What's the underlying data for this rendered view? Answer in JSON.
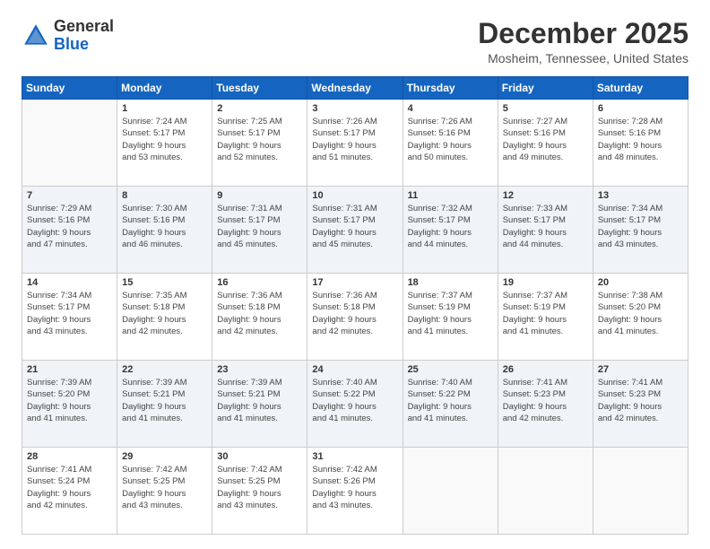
{
  "logo": {
    "general": "General",
    "blue": "Blue"
  },
  "header": {
    "month": "December 2025",
    "location": "Mosheim, Tennessee, United States"
  },
  "days_of_week": [
    "Sunday",
    "Monday",
    "Tuesday",
    "Wednesday",
    "Thursday",
    "Friday",
    "Saturday"
  ],
  "weeks": [
    [
      {
        "day": "",
        "info": ""
      },
      {
        "day": "1",
        "info": "Sunrise: 7:24 AM\nSunset: 5:17 PM\nDaylight: 9 hours\nand 53 minutes."
      },
      {
        "day": "2",
        "info": "Sunrise: 7:25 AM\nSunset: 5:17 PM\nDaylight: 9 hours\nand 52 minutes."
      },
      {
        "day": "3",
        "info": "Sunrise: 7:26 AM\nSunset: 5:17 PM\nDaylight: 9 hours\nand 51 minutes."
      },
      {
        "day": "4",
        "info": "Sunrise: 7:26 AM\nSunset: 5:16 PM\nDaylight: 9 hours\nand 50 minutes."
      },
      {
        "day": "5",
        "info": "Sunrise: 7:27 AM\nSunset: 5:16 PM\nDaylight: 9 hours\nand 49 minutes."
      },
      {
        "day": "6",
        "info": "Sunrise: 7:28 AM\nSunset: 5:16 PM\nDaylight: 9 hours\nand 48 minutes."
      }
    ],
    [
      {
        "day": "7",
        "info": "Sunrise: 7:29 AM\nSunset: 5:16 PM\nDaylight: 9 hours\nand 47 minutes."
      },
      {
        "day": "8",
        "info": "Sunrise: 7:30 AM\nSunset: 5:16 PM\nDaylight: 9 hours\nand 46 minutes."
      },
      {
        "day": "9",
        "info": "Sunrise: 7:31 AM\nSunset: 5:17 PM\nDaylight: 9 hours\nand 45 minutes."
      },
      {
        "day": "10",
        "info": "Sunrise: 7:31 AM\nSunset: 5:17 PM\nDaylight: 9 hours\nand 45 minutes."
      },
      {
        "day": "11",
        "info": "Sunrise: 7:32 AM\nSunset: 5:17 PM\nDaylight: 9 hours\nand 44 minutes."
      },
      {
        "day": "12",
        "info": "Sunrise: 7:33 AM\nSunset: 5:17 PM\nDaylight: 9 hours\nand 44 minutes."
      },
      {
        "day": "13",
        "info": "Sunrise: 7:34 AM\nSunset: 5:17 PM\nDaylight: 9 hours\nand 43 minutes."
      }
    ],
    [
      {
        "day": "14",
        "info": "Sunrise: 7:34 AM\nSunset: 5:17 PM\nDaylight: 9 hours\nand 43 minutes."
      },
      {
        "day": "15",
        "info": "Sunrise: 7:35 AM\nSunset: 5:18 PM\nDaylight: 9 hours\nand 42 minutes."
      },
      {
        "day": "16",
        "info": "Sunrise: 7:36 AM\nSunset: 5:18 PM\nDaylight: 9 hours\nand 42 minutes."
      },
      {
        "day": "17",
        "info": "Sunrise: 7:36 AM\nSunset: 5:18 PM\nDaylight: 9 hours\nand 42 minutes."
      },
      {
        "day": "18",
        "info": "Sunrise: 7:37 AM\nSunset: 5:19 PM\nDaylight: 9 hours\nand 41 minutes."
      },
      {
        "day": "19",
        "info": "Sunrise: 7:37 AM\nSunset: 5:19 PM\nDaylight: 9 hours\nand 41 minutes."
      },
      {
        "day": "20",
        "info": "Sunrise: 7:38 AM\nSunset: 5:20 PM\nDaylight: 9 hours\nand 41 minutes."
      }
    ],
    [
      {
        "day": "21",
        "info": "Sunrise: 7:39 AM\nSunset: 5:20 PM\nDaylight: 9 hours\nand 41 minutes."
      },
      {
        "day": "22",
        "info": "Sunrise: 7:39 AM\nSunset: 5:21 PM\nDaylight: 9 hours\nand 41 minutes."
      },
      {
        "day": "23",
        "info": "Sunrise: 7:39 AM\nSunset: 5:21 PM\nDaylight: 9 hours\nand 41 minutes."
      },
      {
        "day": "24",
        "info": "Sunrise: 7:40 AM\nSunset: 5:22 PM\nDaylight: 9 hours\nand 41 minutes."
      },
      {
        "day": "25",
        "info": "Sunrise: 7:40 AM\nSunset: 5:22 PM\nDaylight: 9 hours\nand 41 minutes."
      },
      {
        "day": "26",
        "info": "Sunrise: 7:41 AM\nSunset: 5:23 PM\nDaylight: 9 hours\nand 42 minutes."
      },
      {
        "day": "27",
        "info": "Sunrise: 7:41 AM\nSunset: 5:23 PM\nDaylight: 9 hours\nand 42 minutes."
      }
    ],
    [
      {
        "day": "28",
        "info": "Sunrise: 7:41 AM\nSunset: 5:24 PM\nDaylight: 9 hours\nand 42 minutes."
      },
      {
        "day": "29",
        "info": "Sunrise: 7:42 AM\nSunset: 5:25 PM\nDaylight: 9 hours\nand 43 minutes."
      },
      {
        "day": "30",
        "info": "Sunrise: 7:42 AM\nSunset: 5:25 PM\nDaylight: 9 hours\nand 43 minutes."
      },
      {
        "day": "31",
        "info": "Sunrise: 7:42 AM\nSunset: 5:26 PM\nDaylight: 9 hours\nand 43 minutes."
      },
      {
        "day": "",
        "info": ""
      },
      {
        "day": "",
        "info": ""
      },
      {
        "day": "",
        "info": ""
      }
    ]
  ]
}
